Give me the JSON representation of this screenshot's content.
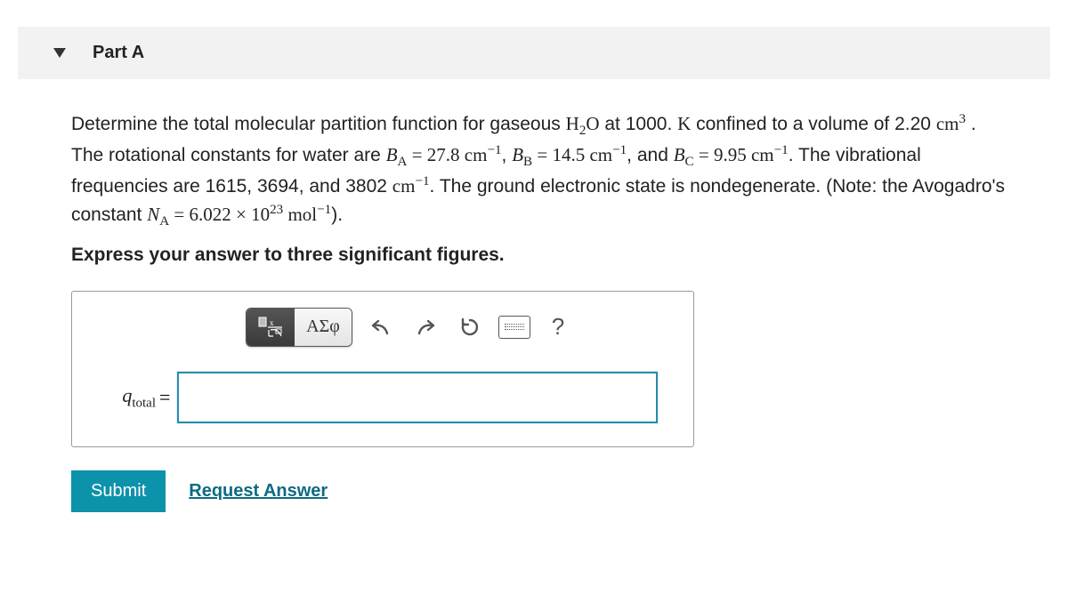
{
  "part": {
    "label": "Part A"
  },
  "problem": {
    "lead": "Determine the total molecular partition function for gaseous ",
    "molecule_base": "H",
    "molecule_sub": "2",
    "molecule_tail": "O",
    "at_text": " at 1000. ",
    "kelvin": "K",
    "confine": " confined to a volume of 2.20 ",
    "vol_unit_base": "cm",
    "vol_exp": "3",
    "rot_lead": " . The rotational constants for water are ",
    "BA_sym": "B",
    "BA_sub": "A",
    "eq": " = ",
    "BA_val": "27.8 cm",
    "neg1": "−1",
    "comma": ", ",
    "BB_sym": "B",
    "BB_sub": "B",
    "BB_val": "14.5 cm",
    "and": ", and ",
    "BC_sym": "B",
    "BC_sub": "C",
    "BC_val": "9.95 cm",
    "vib_lead": ". The vibrational frequencies are 1615, 3694, and 3802 ",
    "vib_unit": "cm",
    "ground": ". The ground electronic state is nondegenerate. (Note: the Avogadro's constant ",
    "NA_sym": "N",
    "NA_sub": "A",
    "NA_val": "6.022 × 10",
    "NA_exp": "23",
    "NA_unit": " mol",
    "close": ")."
  },
  "instruction": "Express your answer to three significant figures.",
  "toolbar": {
    "greek_label": "ΑΣφ",
    "help": "?"
  },
  "input": {
    "var": "q",
    "var_sub": "total",
    "equals": " =",
    "value": ""
  },
  "actions": {
    "submit": "Submit",
    "request": "Request Answer"
  }
}
